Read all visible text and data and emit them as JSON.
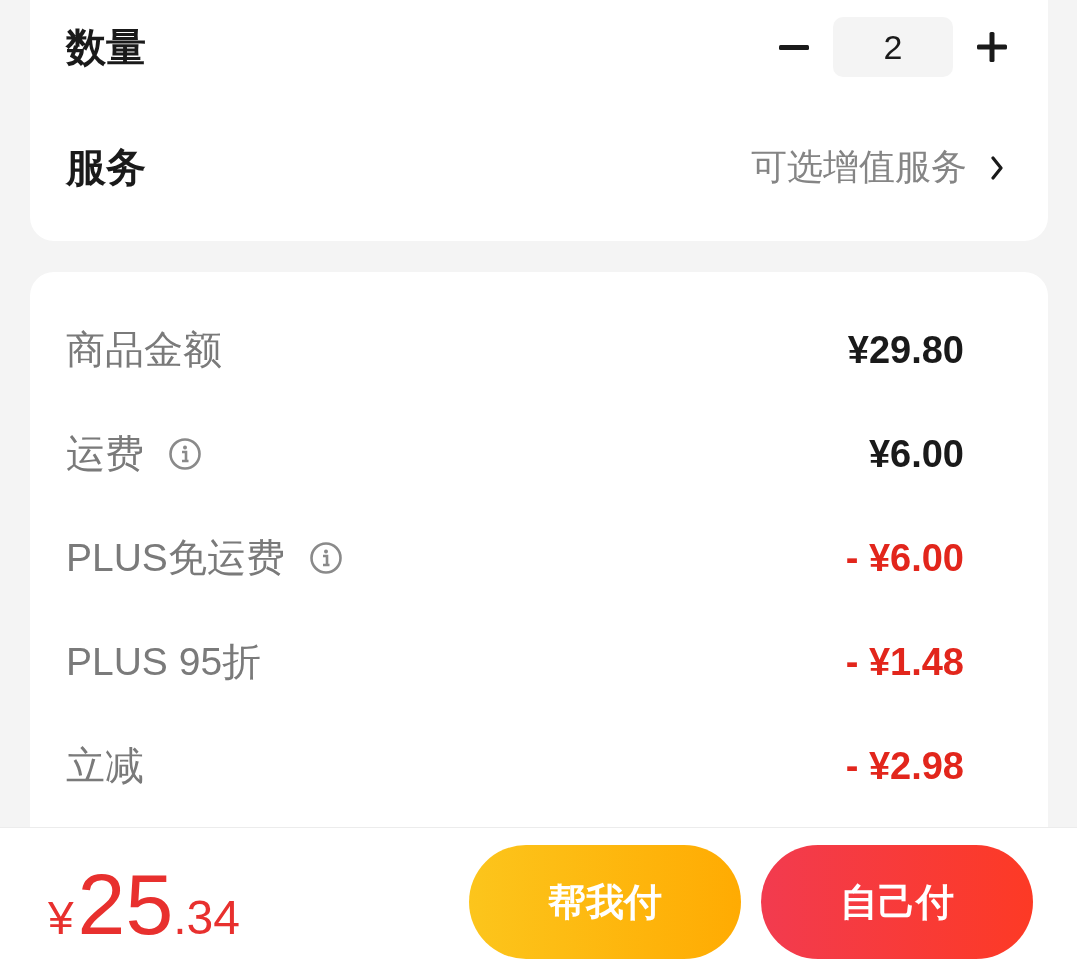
{
  "item_card": {
    "rows": [
      {
        "kind": "stepper",
        "label": "数量",
        "value": "2"
      },
      {
        "kind": "link",
        "label": "服务",
        "value": "可选增值服务"
      }
    ]
  },
  "price_card": {
    "rows": [
      {
        "label": "商品金额",
        "value": "¥29.80",
        "info": false,
        "discount": false
      },
      {
        "label": "运费",
        "value": "¥6.00",
        "info": true,
        "discount": false
      },
      {
        "label": "PLUS免运费",
        "value": "- ¥6.00",
        "info": true,
        "discount": true
      },
      {
        "label": "PLUS 95折",
        "value": "- ¥1.48",
        "info": false,
        "discount": true
      },
      {
        "label": "立减",
        "value": "- ¥2.98",
        "info": false,
        "discount": true
      }
    ]
  },
  "footer": {
    "total": {
      "currency": "¥",
      "whole": "25",
      "fraction": ".34"
    },
    "buttons": [
      {
        "label": "帮我付",
        "kind": "secondary"
      },
      {
        "label": "自己付",
        "kind": "primary"
      }
    ]
  }
}
